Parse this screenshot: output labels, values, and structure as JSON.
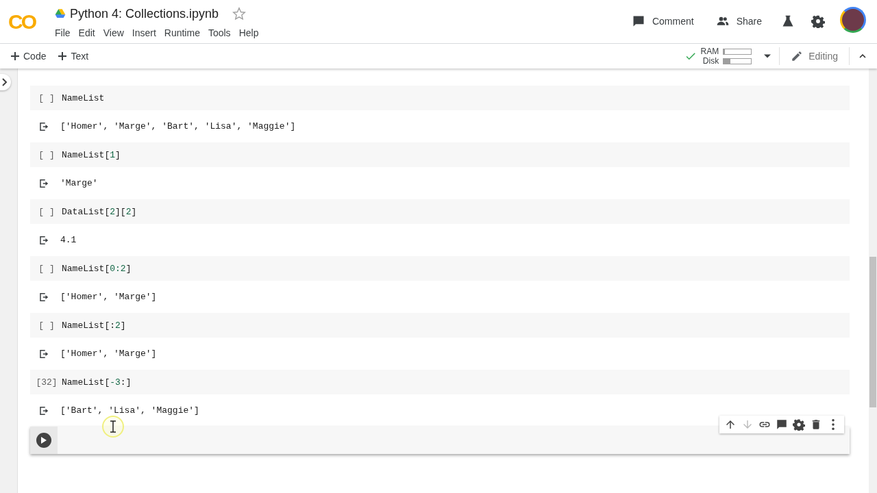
{
  "header": {
    "logo": "CO",
    "title": "Python 4: Collections.ipynb",
    "starred": false,
    "menu": [
      "File",
      "Edit",
      "View",
      "Insert",
      "Runtime",
      "Tools",
      "Help"
    ],
    "actions": [
      {
        "kind": "comment",
        "label": "Comment"
      },
      {
        "kind": "share",
        "label": "Share"
      }
    ]
  },
  "toolbar": {
    "add_buttons": [
      {
        "label": "Code"
      },
      {
        "label": "Text"
      }
    ],
    "resources": {
      "connected": true,
      "ram_label": "RAM",
      "ram": {
        "level": 0.05
      },
      "disk_label": "Disk",
      "disk": {
        "level": 0.25
      }
    },
    "mode": "Editing"
  },
  "cells": [
    {
      "prompt": "[ ]",
      "code": [
        {
          "text": "NameList"
        }
      ],
      "output": "['Homer', 'Marge', 'Bart', 'Lisa', 'Maggie']"
    },
    {
      "prompt": "[ ]",
      "code": [
        {
          "text": "NameList["
        },
        {
          "text": "1",
          "kind": "number"
        },
        {
          "text": "]"
        }
      ],
      "output": "'Marge'"
    },
    {
      "prompt": "[ ]",
      "code": [
        {
          "text": "DataList["
        },
        {
          "text": "2",
          "kind": "number"
        },
        {
          "text": "]["
        },
        {
          "text": "2",
          "kind": "number"
        },
        {
          "text": "]"
        }
      ],
      "output": "4.1"
    },
    {
      "prompt": "[ ]",
      "code": [
        {
          "text": "NameList["
        },
        {
          "text": "0:2",
          "kind": "number"
        },
        {
          "text": "]"
        }
      ],
      "output": "['Homer', 'Marge']"
    },
    {
      "prompt": "[ ]",
      "code": [
        {
          "text": "NameList[:"
        },
        {
          "text": "2",
          "kind": "number"
        },
        {
          "text": "]"
        }
      ],
      "output": "['Homer', 'Marge']"
    },
    {
      "prompt": "[32]",
      "code": [
        {
          "text": "NameList["
        },
        {
          "text": "-3",
          "kind": "number"
        },
        {
          "text": ":]"
        }
      ],
      "output": "['Bart', 'Lisa', 'Maggie']"
    }
  ],
  "active_cell": {
    "focused": true
  }
}
